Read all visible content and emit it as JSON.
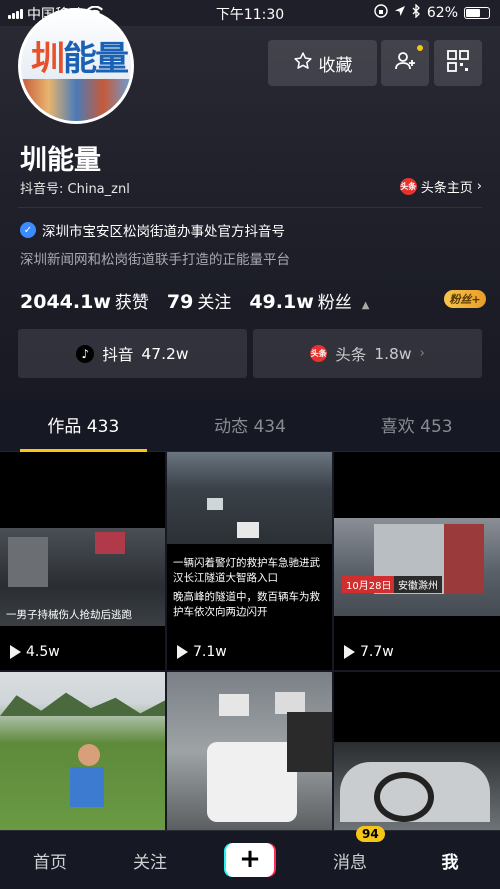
{
  "status_bar": {
    "carrier": "中国移动",
    "time": "下午11:30",
    "battery": "62%",
    "battery_level": 0.62
  },
  "profile": {
    "avatar_text": "圳能量",
    "name": "圳能量",
    "douyin_id": "抖音号: China_znl",
    "toutiao_link": "头条主页",
    "toutiao_badge": "头条",
    "verified_text": "深圳市宝安区松岗街道办事处官方抖音号",
    "bio": "深圳新闻网和松岗街道联手打造的正能量平台",
    "collect_label": "收藏",
    "fans_badge": "粉丝+"
  },
  "stats": {
    "likes_value": "2044.1w",
    "likes_label": "获赞",
    "following_value": "79",
    "following_label": "关注",
    "fans_value": "49.1w",
    "fans_label": "粉丝"
  },
  "platforms": {
    "douyin_label": "抖音",
    "douyin_value": "47.2w",
    "toutiao_label": "头条",
    "toutiao_value": "1.8w"
  },
  "tabs": [
    {
      "label": "作品 433",
      "active": true
    },
    {
      "label": "动态 434",
      "active": false
    },
    {
      "label": "喜欢 453",
      "active": false
    }
  ],
  "videos": [
    {
      "plays": "4.5w",
      "caption": "一男子持械伤人抢劫后逃跑"
    },
    {
      "plays": "7.1w",
      "caption": "一辆闪着警灯的救护车急驰进武汉长江隧道大智路入口",
      "caption2": "晚高峰的隧道中，数百辆车为救护车依次向两边闪开"
    },
    {
      "plays": "7.7w",
      "tag": "10月28日",
      "tag2": "安徽滁州"
    },
    {
      "plays": ""
    },
    {
      "plays": ""
    },
    {
      "plays": ""
    }
  ],
  "tabbar": {
    "home": "首页",
    "following": "关注",
    "messages": "消息",
    "messages_badge": "94",
    "me": "我"
  }
}
